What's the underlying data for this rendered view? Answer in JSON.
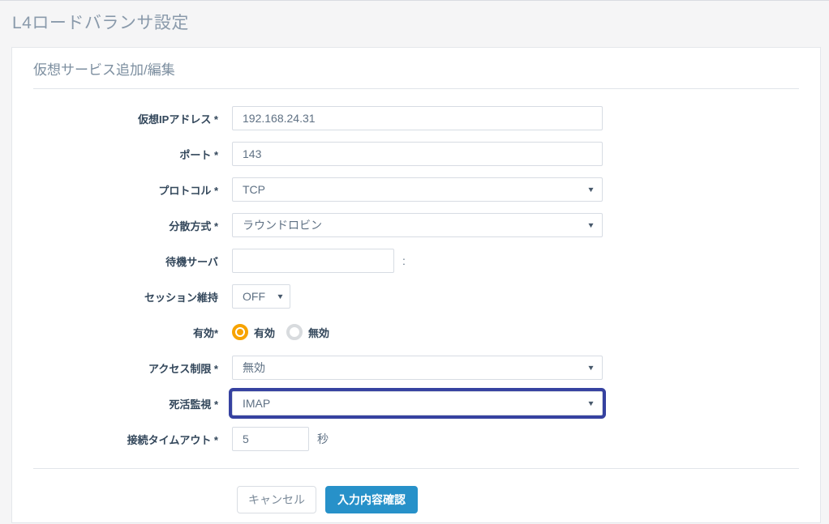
{
  "page": {
    "title": "L4ロードバランサ設定"
  },
  "panel": {
    "title": "仮想サービス追加/編集"
  },
  "icons": {
    "chevron_down": "▼"
  },
  "form": {
    "vip": {
      "label": "仮想IPアドレス *",
      "value": "192.168.24.31"
    },
    "port": {
      "label": "ポート *",
      "value": "143"
    },
    "protocol": {
      "label": "プロトコル *",
      "value": "TCP"
    },
    "method": {
      "label": "分散方式 *",
      "value": "ラウンドロビン"
    },
    "standby": {
      "label": "待機サーバ",
      "value": "",
      "suffix": ":"
    },
    "session": {
      "label": "セッション維持",
      "value": "OFF"
    },
    "enabled": {
      "label": "有効*",
      "options": [
        {
          "label": "有効",
          "selected": true
        },
        {
          "label": "無効",
          "selected": false
        }
      ]
    },
    "access": {
      "label": "アクセス制限 *",
      "value": "無効"
    },
    "healthcheck": {
      "label": "死活監視 *",
      "value": "IMAP",
      "highlighted": true
    },
    "timeout": {
      "label": "接続タイムアウト *",
      "value": "5",
      "suffix": "秒"
    }
  },
  "buttons": {
    "cancel": "キャンセル",
    "confirm": "入力内容確認"
  },
  "colors": {
    "accent_blue": "#2791c9",
    "highlight_border": "#3642a0",
    "radio_orange": "#f7a300",
    "label_navy": "#33475b",
    "page_bg": "#f5f5f6"
  }
}
